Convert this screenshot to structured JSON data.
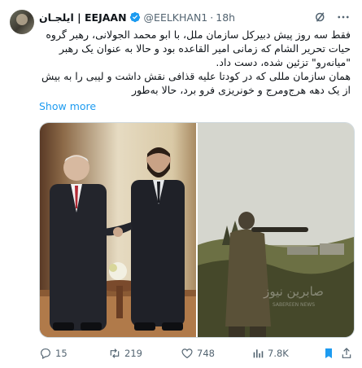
{
  "author": {
    "display_name": "ایلجـان | EEJAAN",
    "handle": "@EELKHAN1",
    "time": "18h"
  },
  "tweet": {
    "paragraph_1": "فقط سه روز پیش دبیرکل سازمان ملل، با ابو محمد الجولانی، رهبر گروه حیات تحریر الشام که زمانی امیر القاعده بود و حالا به عنوان یک رهبر \"میانه‌رو\" تزئین شده، دست داد.",
    "paragraph_2": "همان سازمان مللی که در کودتا علیه قذافی نقش داشت و لیبی را به بیش از یک دهه هرج‌ومرج و خونریزی فرو برد، حالا به‌طور",
    "show_more": "Show more"
  },
  "media": {
    "watermark": "صابرین نیوز",
    "watermark_sub": "SABEREEN NEWS"
  },
  "actions": {
    "replies": "15",
    "reposts": "219",
    "likes": "748",
    "views": "7.8K"
  },
  "colors": {
    "accent": "#1d9bf0",
    "muted": "#536471",
    "bookmark": "#1d9bf0"
  }
}
